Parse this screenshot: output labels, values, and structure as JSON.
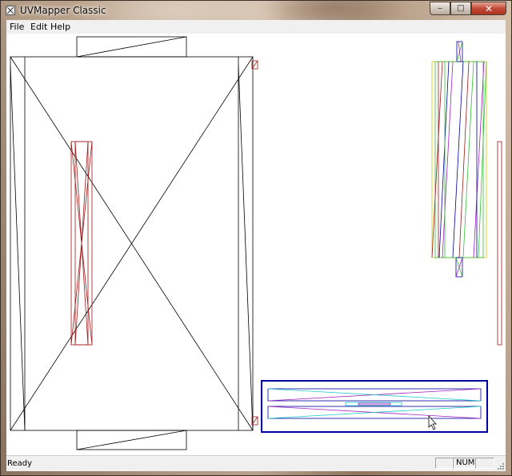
{
  "window": {
    "title": "UVMapper Classic"
  },
  "menu": [
    "File",
    "Edit",
    "Help"
  ],
  "caption_buttons": {
    "minimize": "‒",
    "maximize": "□",
    "close": "✕"
  },
  "status": {
    "text": "Ready",
    "num_indicator": "NUM"
  },
  "colors": {
    "wire": "#000000",
    "red": "#a01818",
    "purple": "#a020c0",
    "cyan": "#20c8c8",
    "blue": "#0000a0",
    "yellow": "#d8c800",
    "green": "#30c030"
  }
}
